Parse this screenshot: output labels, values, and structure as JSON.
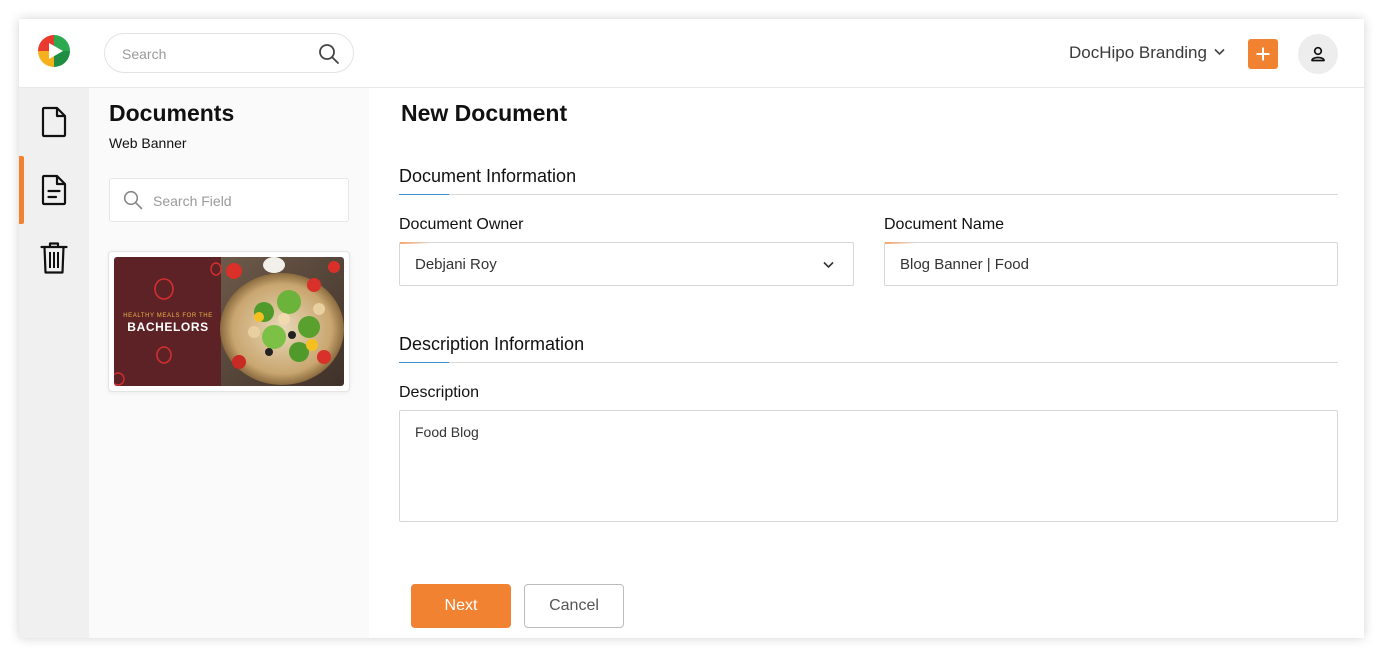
{
  "header": {
    "search_placeholder": "Search",
    "workspace_label": "DocHipo Branding",
    "accent_color": "#f08232"
  },
  "rail": {
    "items": [
      {
        "icon": "document-icon",
        "active": false
      },
      {
        "icon": "document-text-icon",
        "active": true
      },
      {
        "icon": "trash-icon",
        "active": false
      }
    ]
  },
  "documents_panel": {
    "title": "Documents",
    "subtitle": "Web Banner",
    "search_placeholder": "Search Field",
    "thumbnail": {
      "text_small": "HEALTHY MEALS FOR THE",
      "text_large": "BACHELORS"
    }
  },
  "form": {
    "title": "New Document",
    "document_information": {
      "heading": "Document Information",
      "owner_label": "Document Owner",
      "owner_value": "Debjani Roy",
      "name_label": "Document Name",
      "name_value": "Blog Banner | Food"
    },
    "description_information": {
      "heading": "Description Information",
      "description_label": "Description",
      "description_value": "Food Blog"
    },
    "buttons": {
      "next": "Next",
      "cancel": "Cancel"
    }
  }
}
